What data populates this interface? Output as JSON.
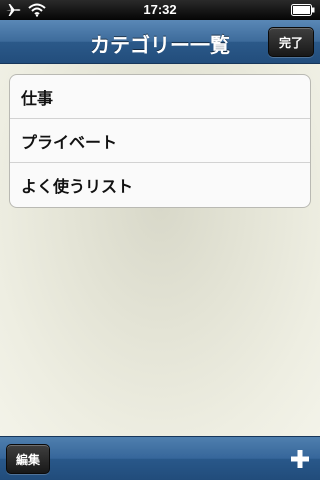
{
  "status_bar": {
    "time": "17:32",
    "icons": [
      "airplane-icon",
      "wifi-icon",
      "battery-icon"
    ]
  },
  "nav_bar": {
    "title": "カテゴリー一覧",
    "done_label": "完了"
  },
  "categories": [
    {
      "label": "仕事"
    },
    {
      "label": "プライベート"
    },
    {
      "label": "よく使うリスト"
    }
  ],
  "toolbar": {
    "edit_label": "編集",
    "add_icon": "plus-icon"
  },
  "colors": {
    "nav_blue": "#2b5989",
    "background": "#e8e8da"
  }
}
